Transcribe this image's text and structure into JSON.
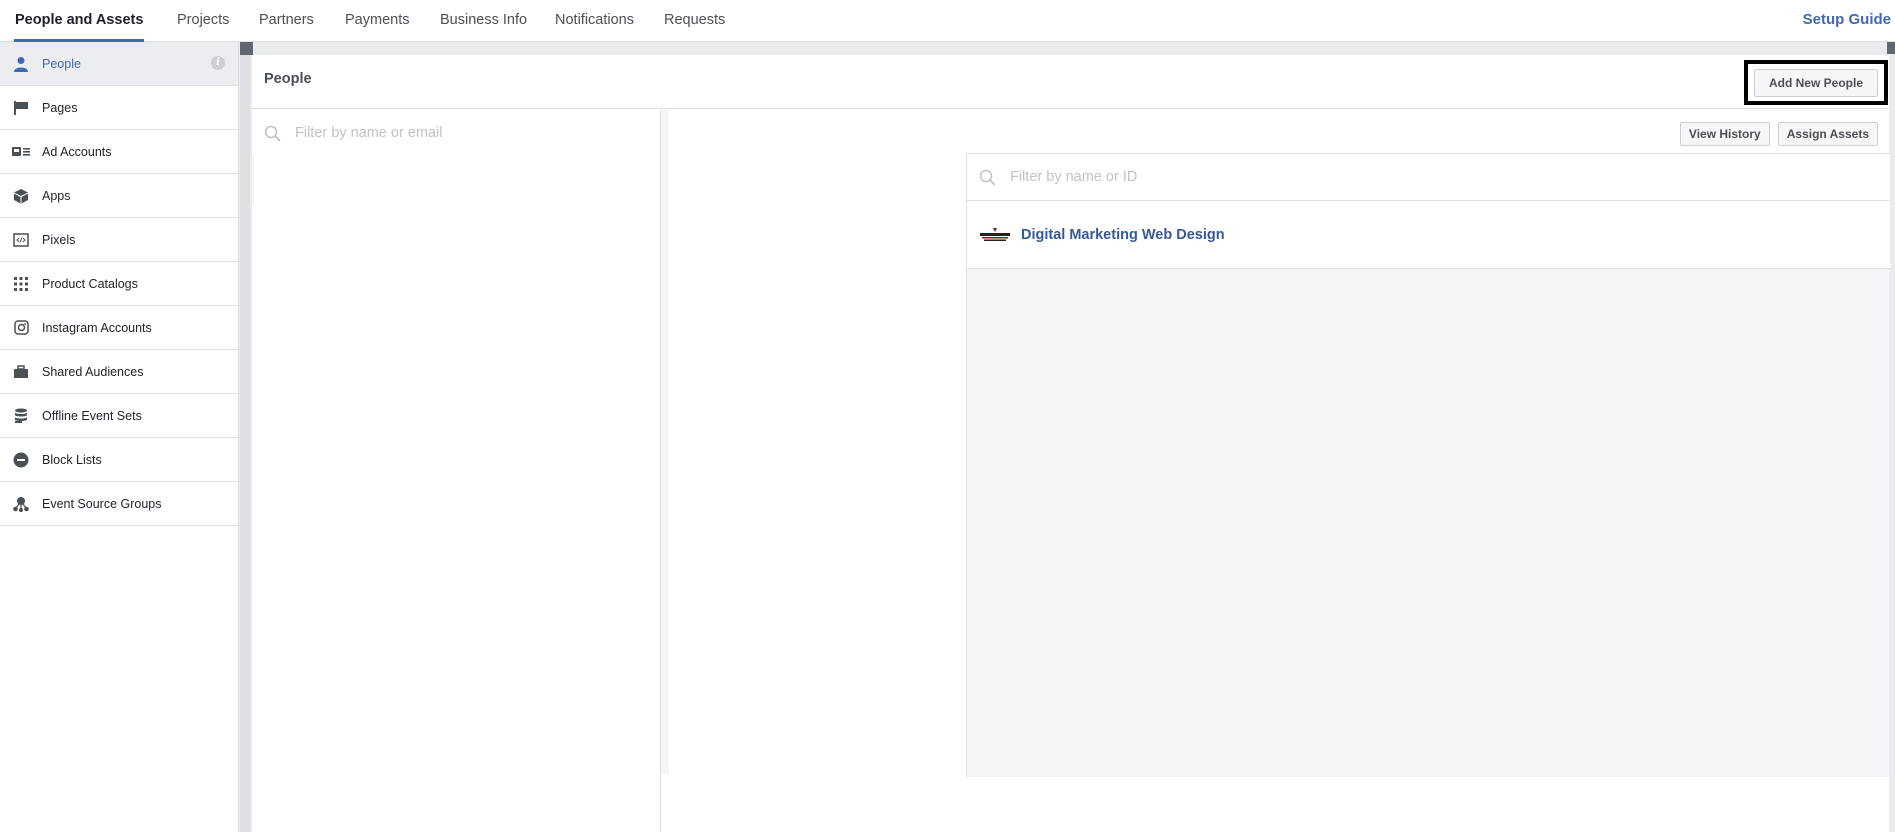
{
  "topnav": {
    "tabs": [
      "People and Assets",
      "Projects",
      "Partners",
      "Payments",
      "Business Info",
      "Notifications",
      "Requests"
    ],
    "active_tab": "People and Assets",
    "setup_guide": "Setup Guide"
  },
  "sidebar": {
    "items": [
      {
        "label": "People",
        "icon": "person-icon",
        "active": true
      },
      {
        "label": "Pages",
        "icon": "flag-icon"
      },
      {
        "label": "Ad Accounts",
        "icon": "ad-account-icon"
      },
      {
        "label": "Apps",
        "icon": "cube-icon"
      },
      {
        "label": "Pixels",
        "icon": "code-icon"
      },
      {
        "label": "Product Catalogs",
        "icon": "grid-icon"
      },
      {
        "label": "Instagram Accounts",
        "icon": "instagram-icon"
      },
      {
        "label": "Shared Audiences",
        "icon": "briefcase-icon"
      },
      {
        "label": "Offline Event Sets",
        "icon": "database-icon"
      },
      {
        "label": "Block Lists",
        "icon": "minus-circle-icon"
      },
      {
        "label": "Event Source Groups",
        "icon": "network-icon"
      }
    ]
  },
  "main": {
    "title": "People",
    "add_button": "Add New People",
    "people_search_placeholder": "Filter by name or email",
    "view_history": "View History",
    "assign_assets": "Assign Assets",
    "assets_search_placeholder": "Filter by name or ID",
    "assets": [
      {
        "name": "Digital Marketing Web Design",
        "logo_text": "DIGITAL MARKETING"
      }
    ]
  },
  "colors": {
    "accent": "#4267b2",
    "link": "#385898",
    "background": "#e9ebee",
    "border": "#dddfe2"
  }
}
